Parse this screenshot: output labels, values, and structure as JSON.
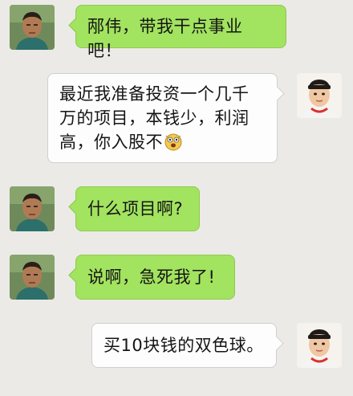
{
  "messages": [
    {
      "side": "left",
      "avatar": "male-avatar-1",
      "text": "邴伟，带我干点事业吧！"
    },
    {
      "side": "right",
      "avatar": "male-avatar-2",
      "text": "最近我准备投资一个几千万的项目，本钱少，利润高，你入股不",
      "emoji": "shocked-face-emoji"
    },
    {
      "side": "left",
      "avatar": "male-avatar-1",
      "text": "什么项目啊?"
    },
    {
      "side": "left",
      "avatar": "male-avatar-1",
      "text": "说啊，急死我了!"
    },
    {
      "side": "right",
      "avatar": "male-avatar-2",
      "text": "买10块钱的双色球。"
    }
  ],
  "colors": {
    "background": "#eceae6",
    "sent_bubble": "#a2e35f",
    "received_bubble": "#fdfdfd"
  }
}
